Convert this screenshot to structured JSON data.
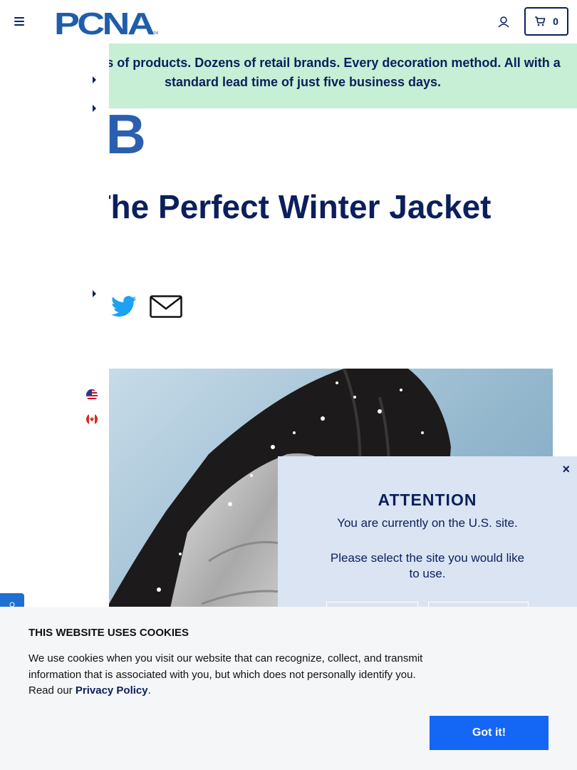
{
  "header": {
    "logo_text": "PCNA",
    "trademark": "TM",
    "cart_count": "0"
  },
  "banner": {
    "text": "Thousands of products. Dozens of retail brands. Every decoration method. All with a standard lead time of just five business days."
  },
  "article": {
    "brand": "HUB",
    "title": "Anatomy Of The Perfect Winter Jacket"
  },
  "modal": {
    "title": "ATTENTION",
    "line1": "You are currently on the U.S. site.",
    "line2": "Please select the site you would like to use.",
    "close_label": "×"
  },
  "cookie": {
    "title": "THIS WEBSITE USES COOKIES",
    "text": "We use cookies when you visit our website that can recognize, collect, and transmit information that is associated with you, but which does not personally identify you. Read our ",
    "link": "Privacy Policy",
    "after": ".",
    "button": "Got it!"
  },
  "colors": {
    "navy": "#0b1f5c",
    "banner_bg": "#c6efd5",
    "modal_bg": "#dbe4f3",
    "cookie_btn": "#1466f5",
    "twitter": "#1da1f2"
  }
}
